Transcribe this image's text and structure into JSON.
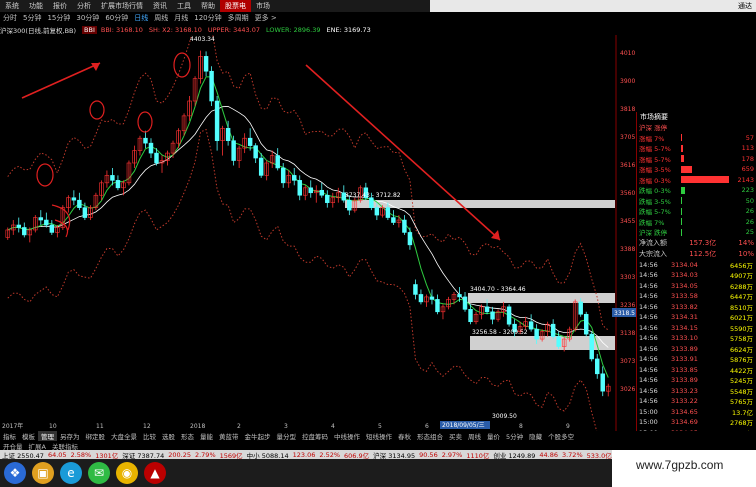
{
  "menu": [
    "系统",
    "功能",
    "报价",
    "分析",
    "扩展市场行情",
    "资讯",
    "工具",
    "帮助"
  ],
  "menu_active": "市场",
  "menu_brand": "股票电",
  "window_right": "通达",
  "periods": [
    "分时",
    "5分钟",
    "15分钟",
    "30分钟",
    "60分钟",
    "日线",
    "周线",
    "月线",
    "120分钟",
    "多周期",
    "更多 >"
  ],
  "period_selected": "日线",
  "legend": {
    "index": "沪深300(日线,前复权,BB)",
    "indicator": "BBI",
    "bbi": "BBI: 3168.10",
    "ma": "SH: X2: 3168.10",
    "upper": "UPPER: 3443.07",
    "lower": "LOWER: 2896.39",
    "ene": "ENE: 3169.73"
  },
  "colors": {
    "up": "#ff3232",
    "down": "#54ffff",
    "bbi": "#ffffff",
    "green_line": "#2ecc40",
    "band": "#c0392b",
    "arrow": "#e02020",
    "level_box": "#d0d0d0"
  },
  "annotations": {
    "high": "4403.34",
    "box1": "3737.43 - 3712.82",
    "box2": "3404.70 - 3364.46",
    "box3": "3256.58 - 3209.52",
    "low": "3009.50",
    "date": "2018/09/05/三",
    "price_tag": "3318.5"
  },
  "yticks": [
    "4010",
    "3900",
    "3818",
    "3705",
    "3616",
    "3560",
    "3455",
    "3388",
    "3303",
    "3236",
    "3138",
    "3073",
    "3026"
  ],
  "xticks": [
    "2017年",
    "10",
    "11",
    "12",
    "2018",
    "2",
    "3",
    "4",
    "5",
    "6",
    "7",
    "8",
    "9"
  ],
  "right_panel": {
    "title": "市场摘要",
    "subtitle_left": "沪深 涨停",
    "stats": [
      {
        "label": "涨幅 7%",
        "value": "57",
        "bar": 0.02,
        "color": "#ff3232"
      },
      {
        "label": "涨幅 5-7%",
        "value": "113",
        "bar": 0.04,
        "color": "#ff3232"
      },
      {
        "label": "涨幅 5-7%",
        "value": "178",
        "bar": 0.06,
        "color": "#ff3232"
      },
      {
        "label": "涨幅 3-5%",
        "value": "659",
        "bar": 0.22,
        "color": "#ff3232"
      },
      {
        "label": "涨幅 0-3%",
        "value": "2143",
        "bar": 0.95,
        "color": "#ff3232"
      },
      {
        "label": "跌幅 0-3%",
        "value": "223",
        "bar": 0.08,
        "color": "#2ecc40"
      },
      {
        "label": "跌幅 3-5%",
        "value": "50",
        "bar": 0.02,
        "color": "#2ecc40"
      },
      {
        "label": "跌幅 5-7%",
        "value": "26",
        "bar": 0.01,
        "color": "#2ecc40"
      },
      {
        "label": "跌幅 7%",
        "value": "26",
        "bar": 0.01,
        "color": "#2ecc40"
      },
      {
        "label": "沪深 跌停",
        "value": "25",
        "bar": 0.01,
        "color": "#2ecc40"
      }
    ],
    "flows": [
      {
        "label": "净流入额",
        "value": "157.3亿",
        "pct": "14%"
      },
      {
        "label": "大宗流入",
        "value": "112.5亿",
        "pct": "10%"
      }
    ],
    "ticks": [
      {
        "t": "14:56",
        "p": "3134.04",
        "v": "6456万"
      },
      {
        "t": "14:56",
        "p": "3134.03",
        "v": "4907万"
      },
      {
        "t": "14:56",
        "p": "3134.05",
        "v": "6288万"
      },
      {
        "t": "14:56",
        "p": "3133.58",
        "v": "6447万"
      },
      {
        "t": "14:56",
        "p": "3133.82",
        "v": "8510万"
      },
      {
        "t": "14:56",
        "p": "3134.31",
        "v": "6021万"
      },
      {
        "t": "14:56",
        "p": "3134.15",
        "v": "5590万"
      },
      {
        "t": "14:56",
        "p": "3133.10",
        "v": "5758万"
      },
      {
        "t": "14:56",
        "p": "3133.89",
        "v": "6624万"
      },
      {
        "t": "14:56",
        "p": "3133.91",
        "v": "5876万"
      },
      {
        "t": "14:56",
        "p": "3133.85",
        "v": "4422万"
      },
      {
        "t": "14:56",
        "p": "3133.89",
        "v": "5245万"
      },
      {
        "t": "14:56",
        "p": "3133.23",
        "v": "5548万"
      },
      {
        "t": "14:56",
        "p": "3133.22",
        "v": "5765万"
      },
      {
        "t": "15:00",
        "p": "3134.65",
        "v": "13.7亿"
      },
      {
        "t": "15:00",
        "p": "3134.69",
        "v": "2768万"
      },
      {
        "t": "15:00",
        "p": "3134.95",
        "v": "2.02亿"
      }
    ]
  },
  "bottom_tabs": [
    "指标",
    "模板",
    "管理",
    "另存为",
    "绑定股",
    "大盘全景",
    "比较",
    "选股",
    "形态",
    "量能",
    "黄蓝带",
    "金牛起步",
    "量分型",
    "控盘筹码",
    "中线操作",
    "短线操作",
    "春秋",
    "形态组合",
    "买卖",
    "周线",
    "量价",
    "5分钟",
    "隐藏",
    "个股多空"
  ],
  "bottom_selected": "管理",
  "bottom_tabs2": [
    "开仓量",
    "扩展A",
    "关联指标"
  ],
  "status": [
    "上证 2550.47",
    "64.05",
    "2.58%",
    "1301亿",
    "深证 7387.74",
    "200.25",
    "2.79%",
    "1569亿",
    "中小 5088.14",
    "123.06",
    "2.52%",
    "606.9亿",
    "沪深 3134.95",
    "90.56",
    "2.97%",
    "1110亿",
    "创业 1249.89",
    "44.86",
    "3.72%",
    "533.0亿",
    "北京行情主站"
  ],
  "watermark": "www.7gpzb.com",
  "candles": [
    [
      3650,
      3690,
      3640,
      3680
    ],
    [
      3680,
      3720,
      3660,
      3700
    ],
    [
      3700,
      3730,
      3670,
      3690
    ],
    [
      3690,
      3710,
      3650,
      3660
    ],
    [
      3660,
      3690,
      3630,
      3680
    ],
    [
      3680,
      3740,
      3670,
      3730
    ],
    [
      3730,
      3760,
      3700,
      3720
    ],
    [
      3720,
      3750,
      3690,
      3700
    ],
    [
      3700,
      3720,
      3660,
      3670
    ],
    [
      3670,
      3700,
      3650,
      3690
    ],
    [
      3690,
      3780,
      3680,
      3770
    ],
    [
      3770,
      3820,
      3750,
      3810
    ],
    [
      3810,
      3840,
      3780,
      3800
    ],
    [
      3800,
      3830,
      3760,
      3770
    ],
    [
      3770,
      3790,
      3720,
      3730
    ],
    [
      3730,
      3780,
      3720,
      3770
    ],
    [
      3770,
      3830,
      3760,
      3820
    ],
    [
      3820,
      3880,
      3800,
      3870
    ],
    [
      3870,
      3920,
      3850,
      3900
    ],
    [
      3900,
      3930,
      3860,
      3880
    ],
    [
      3880,
      3900,
      3840,
      3850
    ],
    [
      3850,
      3880,
      3820,
      3870
    ],
    [
      3870,
      3960,
      3860,
      3950
    ],
    [
      3950,
      4020,
      3930,
      4000
    ],
    [
      4000,
      4060,
      3980,
      4050
    ],
    [
      4050,
      4080,
      4010,
      4030
    ],
    [
      4030,
      4050,
      3970,
      3990
    ],
    [
      3990,
      4010,
      3940,
      3950
    ],
    [
      3950,
      3980,
      3910,
      3960
    ],
    [
      3960,
      4000,
      3940,
      3990
    ],
    [
      3990,
      4040,
      3970,
      4030
    ],
    [
      4030,
      4090,
      4010,
      4080
    ],
    [
      4080,
      4150,
      4060,
      4140
    ],
    [
      4140,
      4220,
      4120,
      4200
    ],
    [
      4200,
      4300,
      4180,
      4290
    ],
    [
      4290,
      4403,
      4270,
      4380
    ],
    [
      4380,
      4400,
      4300,
      4320
    ],
    [
      4320,
      4340,
      4180,
      4200
    ],
    [
      4200,
      4220,
      4000,
      4040
    ],
    [
      4040,
      4100,
      3980,
      4090
    ],
    [
      4090,
      4120,
      4020,
      4040
    ],
    [
      4040,
      4060,
      3940,
      3960
    ],
    [
      3960,
      4020,
      3930,
      4010
    ],
    [
      4010,
      4070,
      3990,
      4050
    ],
    [
      4050,
      4090,
      4000,
      4020
    ],
    [
      4020,
      4030,
      3950,
      3970
    ],
    [
      3970,
      3990,
      3890,
      3900
    ],
    [
      3900,
      3960,
      3880,
      3950
    ],
    [
      3950,
      4000,
      3930,
      3980
    ],
    [
      3980,
      4010,
      3920,
      3930
    ],
    [
      3930,
      3950,
      3850,
      3870
    ],
    [
      3870,
      3920,
      3850,
      3900
    ],
    [
      3900,
      3930,
      3860,
      3880
    ],
    [
      3880,
      3900,
      3800,
      3820
    ],
    [
      3820,
      3860,
      3800,
      3850
    ],
    [
      3850,
      3880,
      3810,
      3830
    ],
    [
      3830,
      3860,
      3790,
      3840
    ],
    [
      3840,
      3870,
      3810,
      3820
    ],
    [
      3820,
      3840,
      3770,
      3790
    ],
    [
      3790,
      3830,
      3770,
      3810
    ],
    [
      3810,
      3850,
      3790,
      3830
    ],
    [
      3830,
      3860,
      3790,
      3800
    ],
    [
      3800,
      3820,
      3740,
      3760
    ],
    [
      3760,
      3810,
      3750,
      3800
    ],
    [
      3800,
      3860,
      3790,
      3850
    ],
    [
      3850,
      3870,
      3800,
      3810
    ],
    [
      3810,
      3830,
      3760,
      3770
    ],
    [
      3770,
      3790,
      3720,
      3740
    ],
    [
      3740,
      3780,
      3730,
      3770
    ],
    [
      3770,
      3790,
      3720,
      3730
    ],
    [
      3730,
      3760,
      3700,
      3710
    ],
    [
      3710,
      3740,
      3690,
      3720
    ],
    [
      3720,
      3740,
      3660,
      3670
    ],
    [
      3670,
      3690,
      3600,
      3620
    ],
    [
      3460,
      3480,
      3400,
      3420
    ],
    [
      3420,
      3440,
      3380,
      3390
    ],
    [
      3390,
      3420,
      3370,
      3410
    ],
    [
      3410,
      3440,
      3380,
      3400
    ],
    [
      3400,
      3420,
      3340,
      3350
    ],
    [
      3350,
      3380,
      3320,
      3370
    ],
    [
      3370,
      3410,
      3360,
      3400
    ],
    [
      3400,
      3430,
      3380,
      3420
    ],
    [
      3420,
      3450,
      3390,
      3410
    ],
    [
      3410,
      3430,
      3350,
      3360
    ],
    [
      3360,
      3380,
      3300,
      3310
    ],
    [
      3310,
      3350,
      3300,
      3340
    ],
    [
      3340,
      3380,
      3320,
      3370
    ],
    [
      3370,
      3400,
      3340,
      3350
    ],
    [
      3350,
      3370,
      3300,
      3320
    ],
    [
      3320,
      3360,
      3310,
      3350
    ],
    [
      3350,
      3390,
      3330,
      3370
    ],
    [
      3370,
      3380,
      3290,
      3300
    ],
    [
      3300,
      3320,
      3250,
      3270
    ],
    [
      3270,
      3310,
      3260,
      3290
    ],
    [
      3290,
      3330,
      3280,
      3310
    ],
    [
      3310,
      3340,
      3270,
      3280
    ],
    [
      3280,
      3300,
      3220,
      3240
    ],
    [
      3240,
      3280,
      3230,
      3270
    ],
    [
      3270,
      3310,
      3250,
      3300
    ],
    [
      3300,
      3320,
      3240,
      3250
    ],
    [
      3250,
      3270,
      3200,
      3210
    ],
    [
      3210,
      3250,
      3190,
      3240
    ],
    [
      3240,
      3290,
      3230,
      3280
    ],
    [
      3280,
      3400,
      3270,
      3390
    ],
    [
      3390,
      3405,
      3330,
      3340
    ],
    [
      3340,
      3350,
      3250,
      3260
    ],
    [
      3260,
      3270,
      3150,
      3160
    ],
    [
      3160,
      3180,
      3080,
      3100
    ],
    [
      3100,
      3130,
      3010,
      3030
    ],
    [
      3030,
      3060,
      3009,
      3050
    ]
  ]
}
